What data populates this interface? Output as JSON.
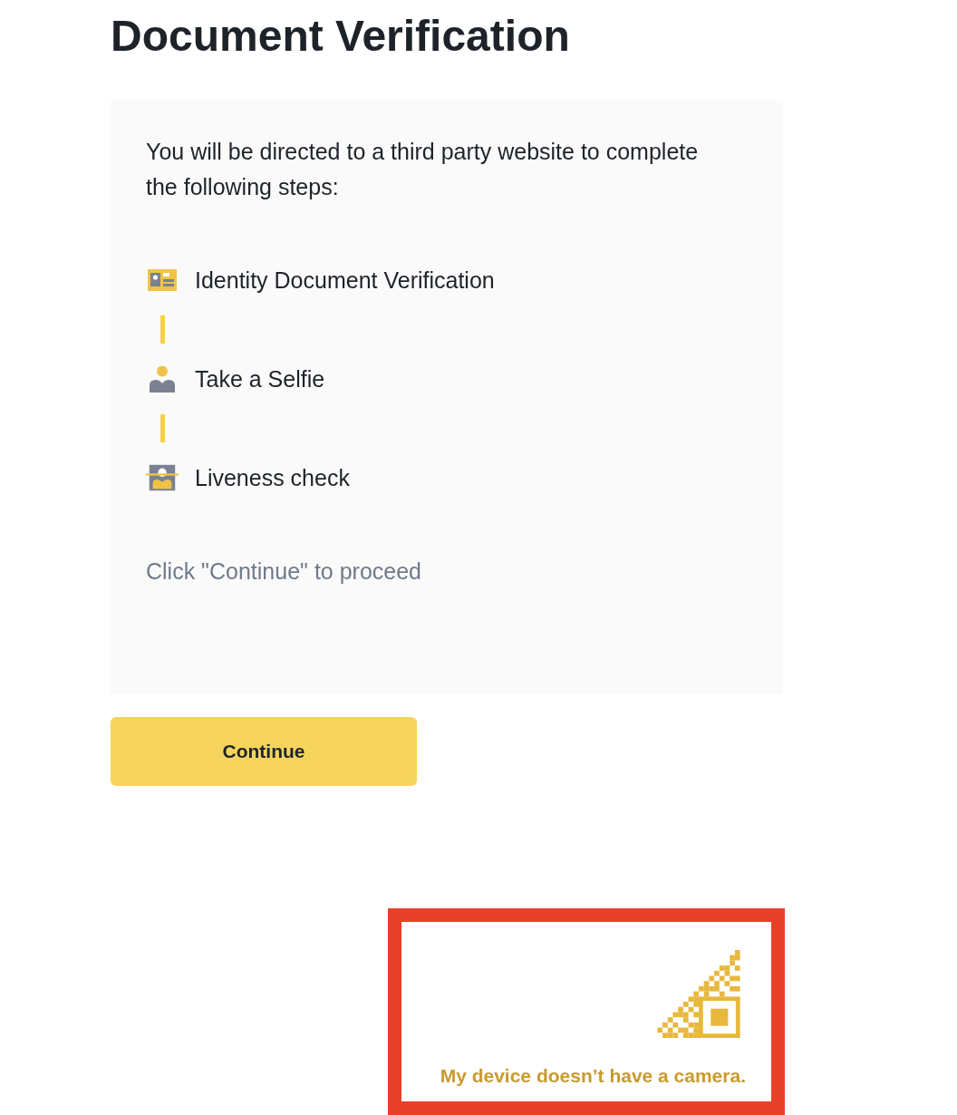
{
  "title": "Document Verification",
  "card": {
    "intro": "You will be directed to a third party website to complete the following steps:",
    "steps": [
      {
        "kind": "id-card",
        "label": "Identity Document Verification"
      },
      {
        "kind": "selfie",
        "label": "Take a Selfie"
      },
      {
        "kind": "liveness",
        "label": "Liveness check"
      }
    ],
    "hint": "Click \"Continue\" to proceed"
  },
  "continue_button": {
    "label": "Continue"
  },
  "highlight_frame": {
    "link": "My device doesn’t have a camera."
  }
}
